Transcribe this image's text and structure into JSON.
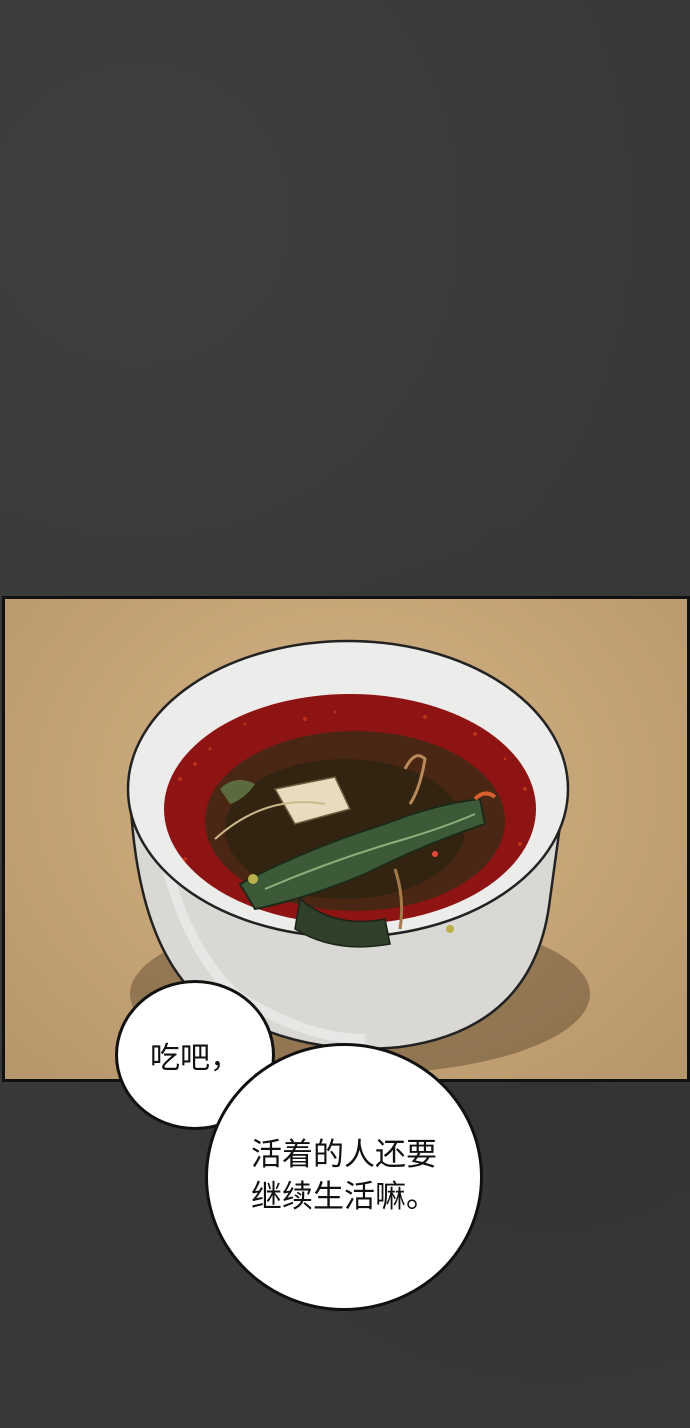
{
  "panel": {
    "image": "bowl-of-soup-illustration",
    "colors": {
      "background": "#393939",
      "table": "#c7a678",
      "bowl": "#e6e6e4",
      "broth": "#8e1414",
      "greens": "#3d5a38"
    }
  },
  "dialogue": {
    "bubble1": "吃吧，",
    "bubble2_line1": "活着的人还要",
    "bubble2_line2": "继续生活嘛。"
  }
}
